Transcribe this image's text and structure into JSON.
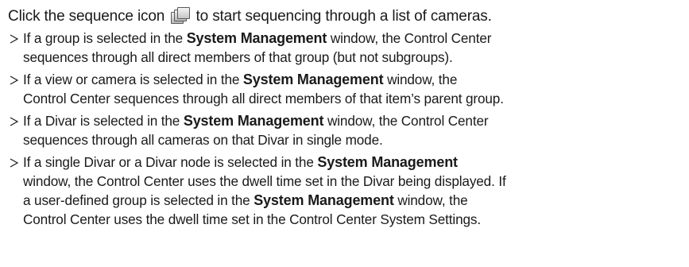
{
  "intro": {
    "before": "Click the sequence icon",
    "icon": "sequence-icon",
    "after": "to start sequencing through a list of cameras."
  },
  "bullet_marker": "&gt;",
  "bullets": [
    {
      "l1a": "If a group is selected in the ",
      "b": "System Management",
      "l1b": " window, the Control Center",
      "l2": "sequences through all direct members of that group (but not subgroups)."
    },
    {
      "l1a": "If a view or camera is selected in the ",
      "b": "System Management",
      "l1b": " window, the",
      "l2": "Control Center sequences through all direct members of that item’s parent group."
    },
    {
      "l1a": "If a Divar is selected in the ",
      "b": "System Management",
      "l1b": " window, the Control Center",
      "l2": "sequences through all cameras on that Divar in single mode."
    },
    {
      "l1a": "If a single Divar or a Divar node is selected in the ",
      "b": "System Management",
      "l2": "window, the Control Center uses the dwell time set in the Divar being displayed. If",
      "l3a": "a user-defined group is selected in the ",
      "b2": "System Management",
      "l3b": " window, the",
      "l4": "Control Center uses the dwell time set in the Control Center System Settings."
    }
  ]
}
